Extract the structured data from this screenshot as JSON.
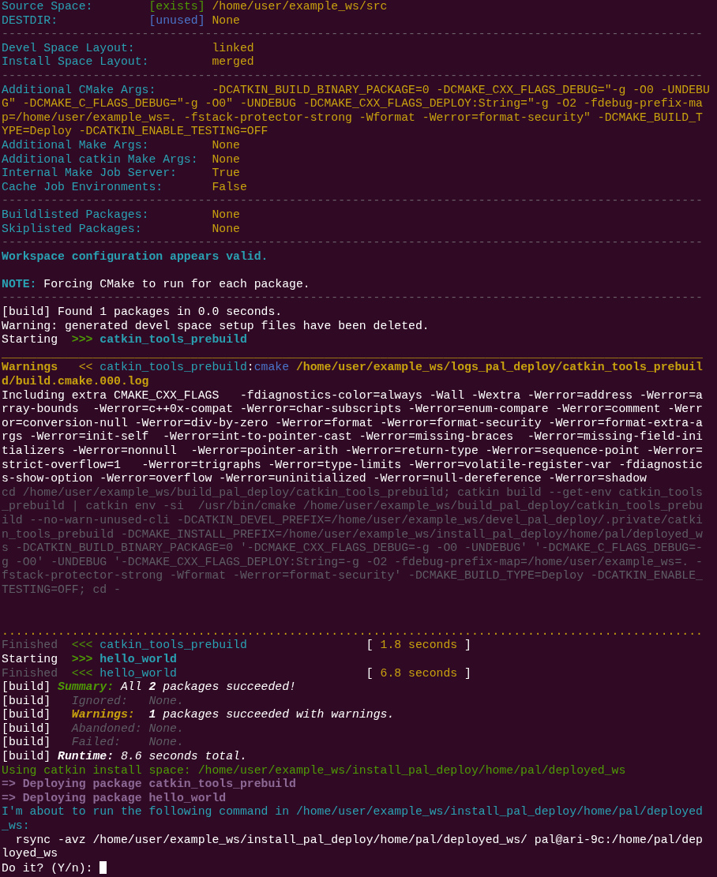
{
  "terminal": {
    "lines": [
      {
        "kind": "text",
        "segs": [
          {
            "t": "Source Space:        ",
            "kind": "label"
          },
          {
            "t": "[exists] ",
            "kind": "ok"
          },
          {
            "t": "/home/user/example_ws/src",
            "kind": "value"
          }
        ]
      },
      {
        "kind": "text",
        "segs": [
          {
            "t": "DESTDIR:             ",
            "kind": "label"
          },
          {
            "t": "[unused] ",
            "kind": "blue"
          },
          {
            "t": "None",
            "kind": "value"
          }
        ]
      },
      {
        "kind": "text",
        "segs": [
          {
            "t": "----------------------------------------------------------------------------------------------------",
            "kind": "rule"
          }
        ]
      },
      {
        "kind": "text",
        "segs": [
          {
            "t": "Devel Space Layout:           ",
            "kind": "label"
          },
          {
            "t": "linked",
            "kind": "value"
          }
        ]
      },
      {
        "kind": "text",
        "segs": [
          {
            "t": "Install Space Layout:         ",
            "kind": "label"
          },
          {
            "t": "merged",
            "kind": "value"
          }
        ]
      },
      {
        "kind": "text",
        "segs": [
          {
            "t": "----------------------------------------------------------------------------------------------------",
            "kind": "rule"
          }
        ]
      },
      {
        "kind": "text",
        "segs": [
          {
            "t": "Additional CMake Args:        ",
            "kind": "label"
          },
          {
            "t": "-DCATKIN_BUILD_BINARY_PACKAGE=0 -DCMAKE_CXX_FLAGS_DEBUG=\"-g -O0 -UNDEBU",
            "kind": "value"
          }
        ]
      },
      {
        "kind": "text",
        "segs": [
          {
            "t": "G\" -DCMAKE_C_FLAGS_DEBUG=\"-g -O0\" -UNDEBUG -DCMAKE_CXX_FLAGS_DEPLOY:String=\"-g -O2 -fdebug-prefix-ma",
            "kind": "value"
          }
        ]
      },
      {
        "kind": "text",
        "segs": [
          {
            "t": "p=/home/user/example_ws=. -fstack-protector-strong -Wformat -Werror=format-security\" -DCMAKE_BUILD_T",
            "kind": "value"
          }
        ]
      },
      {
        "kind": "text",
        "segs": [
          {
            "t": "YPE=Deploy -DCATKIN_ENABLE_TESTING=OFF",
            "kind": "value"
          }
        ]
      },
      {
        "kind": "text",
        "segs": [
          {
            "t": "Additional Make Args:         ",
            "kind": "label"
          },
          {
            "t": "None",
            "kind": "value"
          }
        ]
      },
      {
        "kind": "text",
        "segs": [
          {
            "t": "Additional catkin Make Args:  ",
            "kind": "label"
          },
          {
            "t": "None",
            "kind": "value"
          }
        ]
      },
      {
        "kind": "text",
        "segs": [
          {
            "t": "Internal Make Job Server:     ",
            "kind": "label"
          },
          {
            "t": "True",
            "kind": "value"
          }
        ]
      },
      {
        "kind": "text",
        "segs": [
          {
            "t": "Cache Job Environments:       ",
            "kind": "label"
          },
          {
            "t": "False",
            "kind": "value"
          }
        ]
      },
      {
        "kind": "text",
        "segs": [
          {
            "t": "----------------------------------------------------------------------------------------------------",
            "kind": "rule"
          }
        ]
      },
      {
        "kind": "text",
        "segs": [
          {
            "t": "Buildlisted Packages:         ",
            "kind": "label"
          },
          {
            "t": "None",
            "kind": "value"
          }
        ]
      },
      {
        "kind": "text",
        "segs": [
          {
            "t": "Skiplisted Packages:          ",
            "kind": "label"
          },
          {
            "t": "None",
            "kind": "value"
          }
        ]
      },
      {
        "kind": "text",
        "segs": [
          {
            "t": "----------------------------------------------------------------------------------------------------",
            "kind": "rule"
          }
        ]
      },
      {
        "kind": "text",
        "segs": [
          {
            "t": "Workspace configuration appears valid.",
            "kind": "cyanbold"
          }
        ]
      },
      {
        "kind": "blank"
      },
      {
        "kind": "text",
        "segs": [
          {
            "t": "NOTE: ",
            "kind": "cyanbold"
          },
          {
            "t": "Forcing CMake to run for each package.",
            "kind": "plain"
          }
        ]
      },
      {
        "kind": "text",
        "segs": [
          {
            "t": "----------------------------------------------------------------------------------------------------",
            "kind": "rule"
          }
        ]
      },
      {
        "kind": "text",
        "segs": [
          {
            "t": "[build] Found 1 packages in 0.0 seconds.",
            "kind": "plain"
          }
        ]
      },
      {
        "kind": "text",
        "segs": [
          {
            "t": "Warning: generated devel space setup files have been deleted.",
            "kind": "plain"
          }
        ]
      },
      {
        "kind": "text",
        "segs": [
          {
            "t": "Starting  ",
            "kind": "plain"
          },
          {
            "t": ">>> ",
            "kind": "okbold"
          },
          {
            "t": "catkin_tools_prebuild",
            "kind": "cyanbold"
          }
        ]
      },
      {
        "kind": "text",
        "segs": [
          {
            "t": "____________________________________________________________________________________________________",
            "kind": "yrule"
          }
        ]
      },
      {
        "kind": "text",
        "segs": [
          {
            "t": "Warnings   ",
            "kind": "yellowbold"
          },
          {
            "t": "<< ",
            "kind": "value"
          },
          {
            "t": "catkin_tools_prebuild",
            "kind": "label"
          },
          {
            "t": ":",
            "kind": "plain"
          },
          {
            "t": "cmake ",
            "kind": "blue"
          },
          {
            "t": "/home/user/example_ws/logs_pal_deploy/catkin_tools_prebuil",
            "kind": "yellowbold"
          }
        ]
      },
      {
        "kind": "text",
        "segs": [
          {
            "t": "d/build.cmake.000.log",
            "kind": "yellowbold"
          }
        ]
      },
      {
        "kind": "text",
        "segs": [
          {
            "t": "Including extra CMAKE_CXX_FLAGS   -fdiagnostics-color=always -Wall -Wextra -Werror=address -Werror=a",
            "kind": "plain"
          }
        ]
      },
      {
        "kind": "text",
        "segs": [
          {
            "t": "rray-bounds  -Werror=c++0x-compat -Werror=char-subscripts -Werror=enum-compare -Werror=comment -Werr",
            "kind": "plain"
          }
        ]
      },
      {
        "kind": "text",
        "segs": [
          {
            "t": "or=conversion-null -Werror=div-by-zero -Werror=format -Werror=format-security -Werror=format-extra-a",
            "kind": "plain"
          }
        ]
      },
      {
        "kind": "text",
        "segs": [
          {
            "t": "rgs -Werror=init-self  -Werror=int-to-pointer-cast -Werror=missing-braces  -Werror=missing-field-ini",
            "kind": "plain"
          }
        ]
      },
      {
        "kind": "text",
        "segs": [
          {
            "t": "tializers -Werror=nonnull  -Werror=pointer-arith -Werror=return-type -Werror=sequence-point -Werror=",
            "kind": "plain"
          }
        ]
      },
      {
        "kind": "text",
        "segs": [
          {
            "t": "strict-overflow=1   -Werror=trigraphs -Werror=type-limits -Werror=volatile-register-var -fdiagnostic",
            "kind": "plain"
          }
        ]
      },
      {
        "kind": "text",
        "segs": [
          {
            "t": "s-show-option -Werror=overflow -Werror=uninitialized -Werror=null-dereference -Werror=shadow",
            "kind": "plain"
          }
        ]
      },
      {
        "kind": "text",
        "segs": [
          {
            "t": "cd /home/user/example_ws/build_pal_deploy/catkin_tools_prebuild; catkin build --get-env catkin_tools",
            "kind": "dim"
          }
        ]
      },
      {
        "kind": "text",
        "segs": [
          {
            "t": "_prebuild | catkin env -si  /usr/bin/cmake /home/user/example_ws/build_pal_deploy/catkin_tools_prebu",
            "kind": "dim"
          }
        ]
      },
      {
        "kind": "text",
        "segs": [
          {
            "t": "ild --no-warn-unused-cli -DCATKIN_DEVEL_PREFIX=/home/user/example_ws/devel_pal_deploy/.private/catki",
            "kind": "dim"
          }
        ]
      },
      {
        "kind": "text",
        "segs": [
          {
            "t": "n_tools_prebuild -DCMAKE_INSTALL_PREFIX=/home/user/example_ws/install_pal_deploy/home/pal/deployed_w",
            "kind": "dim"
          }
        ]
      },
      {
        "kind": "text",
        "segs": [
          {
            "t": "s -DCATKIN_BUILD_BINARY_PACKAGE=0 '-DCMAKE_CXX_FLAGS_DEBUG=-g -O0 -UNDEBUG' '-DCMAKE_C_FLAGS_DEBUG=-",
            "kind": "dim"
          }
        ]
      },
      {
        "kind": "text",
        "segs": [
          {
            "t": "g -O0' -UNDEBUG '-DCMAKE_CXX_FLAGS_DEPLOY:String=-g -O2 -fdebug-prefix-map=/home/user/example_ws=. -",
            "kind": "dim"
          }
        ]
      },
      {
        "kind": "text",
        "segs": [
          {
            "t": "fstack-protector-strong -Wformat -Werror=format-security' -DCMAKE_BUILD_TYPE=Deploy -DCATKIN_ENABLE_",
            "kind": "dim"
          }
        ]
      },
      {
        "kind": "text",
        "segs": [
          {
            "t": "TESTING=OFF; cd -",
            "kind": "dim"
          }
        ]
      },
      {
        "kind": "blank"
      },
      {
        "kind": "blank"
      },
      {
        "kind": "text",
        "segs": [
          {
            "t": "....................................................................................................",
            "kind": "yrule"
          }
        ]
      },
      {
        "kind": "text",
        "segs": [
          {
            "t": "Finished  ",
            "kind": "dim"
          },
          {
            "t": "<<< ",
            "kind": "ok"
          },
          {
            "t": "catkin_tools_prebuild                 ",
            "kind": "label"
          },
          {
            "t": "[ ",
            "kind": "plain"
          },
          {
            "t": "1.8 seconds ",
            "kind": "value"
          },
          {
            "t": "]",
            "kind": "plain"
          }
        ]
      },
      {
        "kind": "text",
        "segs": [
          {
            "t": "Starting  ",
            "kind": "plain"
          },
          {
            "t": ">>> ",
            "kind": "okbold"
          },
          {
            "t": "hello_world",
            "kind": "cyanbold"
          }
        ]
      },
      {
        "kind": "text",
        "segs": [
          {
            "t": "Finished  ",
            "kind": "dim"
          },
          {
            "t": "<<< ",
            "kind": "ok"
          },
          {
            "t": "hello_world                           ",
            "kind": "label"
          },
          {
            "t": "[ ",
            "kind": "plain"
          },
          {
            "t": "6.8 seconds ",
            "kind": "value"
          },
          {
            "t": "]",
            "kind": "plain"
          }
        ]
      },
      {
        "kind": "text",
        "segs": [
          {
            "t": "[build] ",
            "kind": "plain"
          },
          {
            "t": "Summary: ",
            "kind": "greenbi"
          },
          {
            "t": "All **2** packages succeeded!",
            "kind": "italic"
          }
        ]
      },
      {
        "kind": "text",
        "segs": [
          {
            "t": "[build]   ",
            "kind": "plain"
          },
          {
            "t": "Ignored:   ",
            "kind": "dimitalic"
          },
          {
            "t": "None.",
            "kind": "dimitalic"
          }
        ]
      },
      {
        "kind": "text",
        "segs": [
          {
            "t": "[build]   ",
            "kind": "plain"
          },
          {
            "t": "Warnings:  ",
            "kind": "yellowbi"
          },
          {
            "t": "**1** packages succeeded with warnings.",
            "kind": "italic"
          }
        ]
      },
      {
        "kind": "text",
        "segs": [
          {
            "t": "[build]   ",
            "kind": "plain"
          },
          {
            "t": "Abandoned: ",
            "kind": "dimitalic"
          },
          {
            "t": "None.",
            "kind": "dimitalic"
          }
        ]
      },
      {
        "kind": "text",
        "segs": [
          {
            "t": "[build]   ",
            "kind": "plain"
          },
          {
            "t": "Failed:    ",
            "kind": "dimitalic"
          },
          {
            "t": "None.",
            "kind": "dimitalic"
          }
        ]
      },
      {
        "kind": "text",
        "segs": [
          {
            "t": "[build] ",
            "kind": "plain"
          },
          {
            "t": "Runtime: ",
            "kind": "bolditalic"
          },
          {
            "t": "8.6 seconds total.",
            "kind": "italic"
          }
        ]
      },
      {
        "kind": "text",
        "segs": [
          {
            "t": "Using catkin install space: /home/user/example_ws/install_pal_deploy/home/pal/deployed_ws",
            "kind": "ok"
          }
        ]
      },
      {
        "kind": "text",
        "segs": [
          {
            "t": "=> Deploying package catkin_tools_prebuild",
            "kind": "purple"
          }
        ]
      },
      {
        "kind": "text",
        "segs": [
          {
            "t": "=> Deploying package hello_world",
            "kind": "purple"
          }
        ]
      },
      {
        "kind": "text",
        "segs": [
          {
            "t": "I'm about to run the following command in /home/user/example_ws/install_pal_deploy/home/pal/deployed",
            "kind": "label"
          }
        ]
      },
      {
        "kind": "text",
        "segs": [
          {
            "t": "_ws:",
            "kind": "label"
          }
        ]
      },
      {
        "kind": "text",
        "segs": [
          {
            "t": "  rsync -avz /home/user/example_ws/install_pal_deploy/home/pal/deployed_ws/ pal@ari-9c:/home/pal/dep",
            "kind": "plain"
          }
        ]
      },
      {
        "kind": "text",
        "segs": [
          {
            "t": "loyed_ws",
            "kind": "plain"
          }
        ]
      },
      {
        "kind": "text",
        "cursor": true,
        "segs": [
          {
            "t": "Do it? (Y/n): ",
            "kind": "plain"
          }
        ]
      }
    ]
  }
}
